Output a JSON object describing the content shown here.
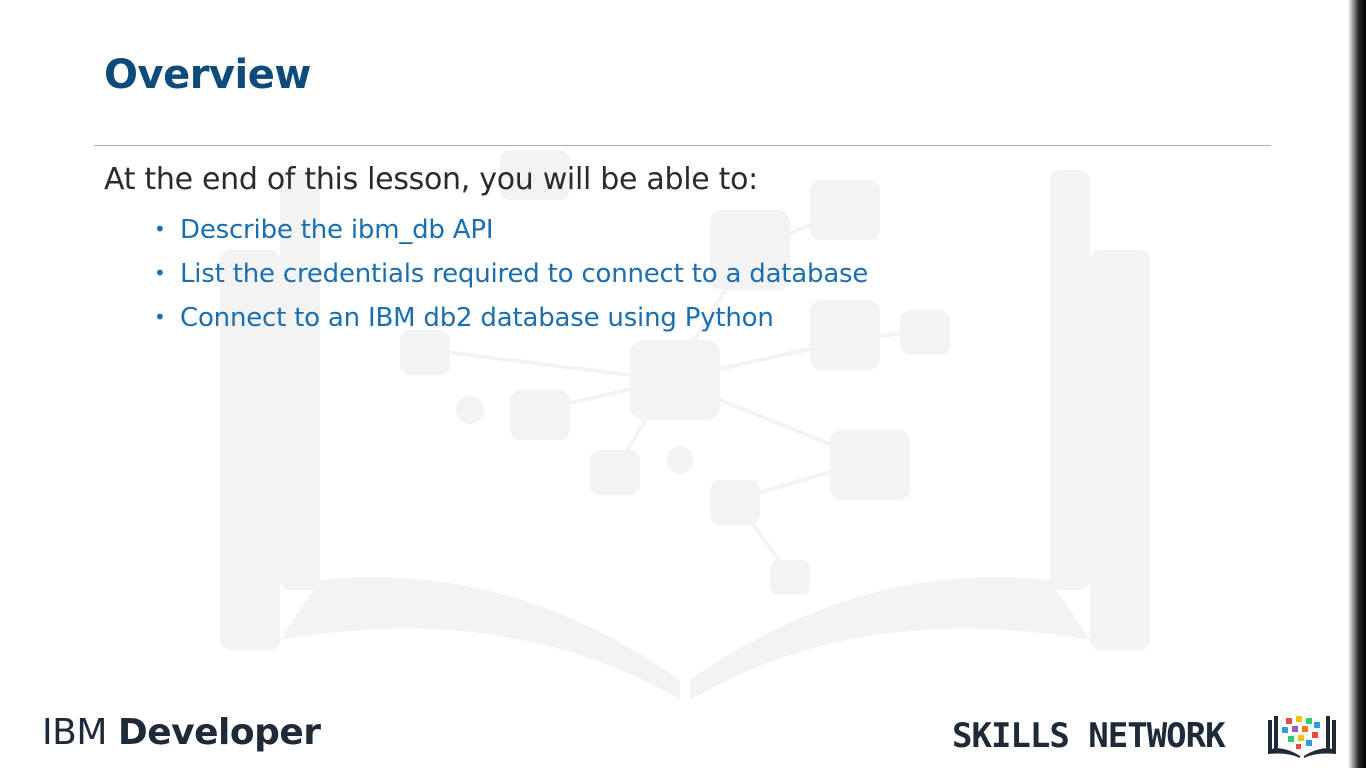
{
  "slide": {
    "title": "Overview",
    "intro": "At the end of this lesson, you will be able to:",
    "bullets": [
      "Describe the ibm_db API",
      "List the credentials required to connect to a database",
      "Connect to an IBM db2 database using Python"
    ]
  },
  "branding": {
    "ibm_prefix": "IBM",
    "ibm_suffix": "Developer",
    "skills_network": "SKILLS NETWORK"
  },
  "colors": {
    "title": "#0e4a7a",
    "bullet_text": "#1b6fb0",
    "body_text": "#2b2b2b",
    "rule": "#9fb3d4"
  },
  "icons": {
    "watermark": "open-book-network-icon",
    "skills_logo": "book-pixel-icon"
  }
}
